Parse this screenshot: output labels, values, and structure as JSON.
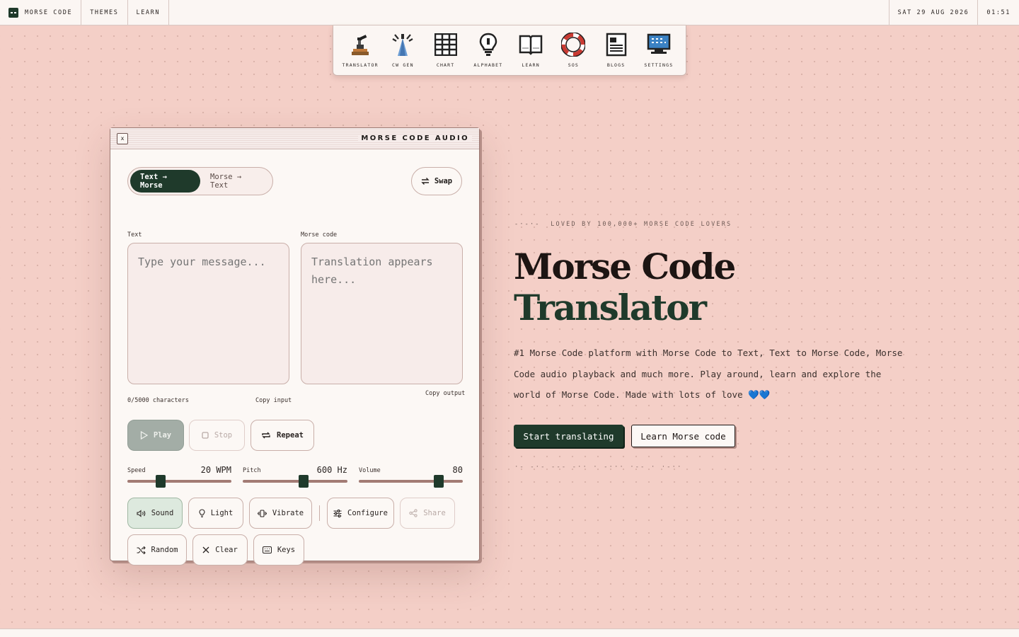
{
  "topbar": {
    "brand": "Morse Code",
    "nav": [
      "Themes",
      "Learn"
    ],
    "date": "SAT 29 AUG 2026",
    "time": "01:51"
  },
  "dock": {
    "items": [
      {
        "label": "Translator",
        "icon": "telegraph-key-icon"
      },
      {
        "label": "CW Gen",
        "icon": "radio-tower-icon"
      },
      {
        "label": "Chart",
        "icon": "grid-chart-icon"
      },
      {
        "label": "Alphabet",
        "icon": "lightbulb-icon"
      },
      {
        "label": "Learn",
        "icon": "open-book-icon"
      },
      {
        "label": "SOS",
        "icon": "lifebuoy-icon"
      },
      {
        "label": "Blogs",
        "icon": "document-icon"
      },
      {
        "label": "Settings",
        "icon": "monitor-icon"
      }
    ]
  },
  "window": {
    "close_label": "x",
    "title": "Morse Code Audio",
    "modes": [
      "Text → Morse",
      "Morse → Text"
    ],
    "swap_label": "Swap",
    "input": {
      "label": "Text",
      "placeholder": "Type your message..."
    },
    "output": {
      "label": "Morse code",
      "placeholder": "Translation appears here..."
    },
    "char_count": "0/5000 characters",
    "copy_input": "Copy input",
    "copy_output": "Copy output",
    "playback": {
      "play": "Play",
      "stop": "Stop",
      "repeat": "Repeat"
    },
    "sliders": [
      {
        "label": "Speed",
        "value": "20 WPM",
        "level": 0.3
      },
      {
        "label": "Pitch",
        "value": "600 Hz",
        "level": 0.59
      },
      {
        "label": "Volume",
        "value": "80",
        "level": 0.8
      }
    ],
    "options": {
      "sound": "Sound",
      "light": "Light",
      "vibrate": "Vibrate",
      "configure": "Configure",
      "share": "Share",
      "random": "Random",
      "clear": "Clear",
      "keys": "Keys"
    }
  },
  "hero": {
    "tagline": "LOVED BY 100,000+ MORSE CODE LOVERS",
    "tag_morse": "-·-·-",
    "title_line1": "Morse Code",
    "title_line2": "Translator",
    "description": "#1 Morse Code platform with Morse Code to Text, Text to Morse Code, Morse Code audio playback and much more. Play around, learn and explore the world of Morse Code. Made with lots of love 💙💙",
    "cta_primary": "Start translating",
    "cta_secondary": "Learn Morse code",
    "morse_decoration": "·- -·- --- -·· · -··· ·-- · ·-··"
  },
  "colors": {
    "background": "#f4cfc7",
    "accent_green": "#1f3a2b",
    "panel": "#fcf8f5",
    "slider_track": "#a27b74"
  }
}
